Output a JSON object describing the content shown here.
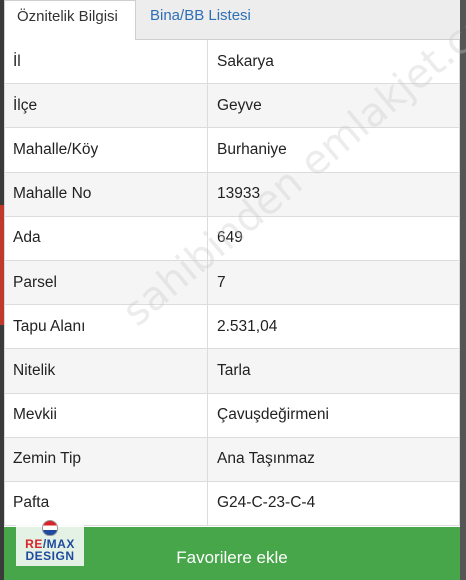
{
  "tabs": [
    {
      "label": "Öznitelik Bilgisi",
      "active": true
    },
    {
      "label": "Bina/BB Listesi",
      "active": false
    }
  ],
  "rows": [
    {
      "key": "İl",
      "value": "Sakarya"
    },
    {
      "key": "İlçe",
      "value": "Geyve"
    },
    {
      "key": "Mahalle/Köy",
      "value": "Burhaniye"
    },
    {
      "key": "Mahalle No",
      "value": "13933"
    },
    {
      "key": "Ada",
      "value": "649"
    },
    {
      "key": "Parsel",
      "value": "7"
    },
    {
      "key": "Tapu Alanı",
      "value": "2.531,04"
    },
    {
      "key": "Nitelik",
      "value": "Tarla"
    },
    {
      "key": "Mevkii",
      "value": "Çavuşdeğirmeni"
    },
    {
      "key": "Zemin Tip",
      "value": "Ana Taşınmaz"
    },
    {
      "key": "Pafta",
      "value": "G24-C-23-C-4"
    }
  ],
  "favorite_button": {
    "label": "Favorilere ekle"
  },
  "watermark": "sahibinden emlakjet.com",
  "logo": {
    "line1_a": "RE",
    "line1_b": "/MAX",
    "line2": "DESIGN"
  },
  "colors": {
    "accent_green": "#47a64a",
    "tab_link": "#2d6fb5"
  }
}
